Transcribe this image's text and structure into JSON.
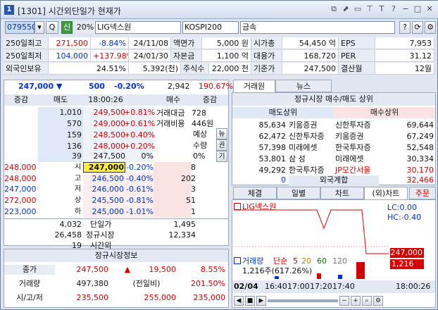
{
  "window": {
    "title": "[1301] 시간외단일가 현재가",
    "num": "1"
  },
  "toolbar": {
    "code": "079550",
    "search": "Q",
    "badge": "신",
    "pct": "20%",
    "name": "LIG넥스원",
    "index": "KOSPI200",
    "sector": "금속",
    "help": "?"
  },
  "info": {
    "r1": [
      "250일최고",
      "271,500",
      "-8.84%",
      "24/11/08",
      "액면가",
      "5,000 원",
      "시가총",
      "54,450 억",
      "EPS",
      "7,953"
    ],
    "r2": [
      "250일최저",
      "104,000",
      "+137.98%",
      "24/01/30",
      "자본금",
      "1,100 억",
      "대용가",
      "168,720",
      "PER",
      "31.12"
    ],
    "r3": [
      "외국인보유",
      "24.51%",
      "5,392(천)",
      "주식수",
      "22,000 천",
      "기준가",
      "247,500",
      "결산월",
      "12월"
    ]
  },
  "quote": {
    "price": "247,000",
    "arrow": "▼",
    "chg": "500",
    "rate": "-0.20%",
    "vol": "2,942",
    "ratio": "190.67%"
  },
  "ob": {
    "h": [
      "증감",
      "매도",
      "18:00:26",
      "매수",
      "증감"
    ],
    "asks": [
      [
        "1,010",
        "249,500",
        "+0.81%"
      ],
      [
        "570",
        "249,000",
        "+0.61%"
      ],
      [
        "159",
        "248,500",
        "+0.40%"
      ],
      [
        "136",
        "248,000",
        "+0.20%"
      ],
      [
        "39",
        "247,500",
        "0%"
      ]
    ],
    "bids": [
      [
        "247,000",
        "-0.20%",
        "8"
      ],
      [
        "246,500",
        "-0.40%",
        "202"
      ],
      [
        "246,000",
        "-0.61%",
        "3"
      ],
      [
        "245,500",
        "-0.81%",
        "51"
      ],
      [
        "245,000",
        "-1.01%",
        "1"
      ]
    ],
    "left": [
      [
        "248,000",
        "시"
      ],
      [
        "248,000",
        "고"
      ],
      [
        "247,000",
        "저"
      ],
      [
        "272,000",
        "상"
      ],
      [
        "223,000",
        "하"
      ]
    ],
    "side": {
      "t1": "거래대금",
      "v1": "728",
      "t2": "거래비용",
      "v2": "446원",
      "t3": "예상",
      "t4": "수량",
      "t5": "0%",
      "t6": "0",
      "n1": "뉴",
      "n2": "권",
      "n3": "기"
    },
    "foot": {
      "sell": "4,032",
      "sell2": "26,458",
      "sell3": "19",
      "l1": "단일가",
      "l2": "정규시장",
      "l3": "시간외",
      "buy": "1,495",
      "buy2": "12,334"
    }
  },
  "regular": {
    "title": "정규시장정보",
    "rows": [
      [
        "종가",
        "247,500",
        "▲",
        "19,500",
        "8.55%"
      ],
      [
        "거래량",
        "497,380",
        "(전일비)",
        "201.50%"
      ],
      [
        "시/고/저",
        "235,500",
        "255,000",
        "235,000"
      ]
    ]
  },
  "broker": {
    "tabs": [
      "거래원",
      "뉴스"
    ],
    "title": "정규시장 매수/매도 상위",
    "h": [
      "매도상위",
      "매수상위"
    ],
    "rows": [
      [
        "85,634",
        "키움증권",
        "신한투자증",
        "69,644"
      ],
      [
        "62,472",
        "신한투자증",
        "키움증권",
        "67,249"
      ],
      [
        "57,398",
        "미래에셋",
        "한국투자증",
        "52,548"
      ],
      [
        "53,801",
        "삼 성",
        "미래에셋",
        "30,334"
      ],
      [
        "49,292",
        "한국투자증",
        "JP모간서울",
        "30,170"
      ]
    ],
    "foreign": [
      "0",
      "외국계합",
      "32,466"
    ]
  },
  "chart": {
    "tabs": [
      "체결",
      "일별",
      "차트",
      "(외)차트",
      "주문"
    ],
    "name": "LIG넥스원",
    "lc": "LC:0.00",
    "hc": "HC:-0.40",
    "plabel": "247,000",
    "vlabel": "1,216",
    "legend": [
      "거래량",
      "단순",
      "5",
      "20",
      "60",
      "120"
    ],
    "vtext": "1,216주(617.26%)",
    "date": "02/04",
    "times": [
      "16:40",
      "17:00",
      "17:20",
      "17:40"
    ],
    "now": "18:00:26"
  }
}
